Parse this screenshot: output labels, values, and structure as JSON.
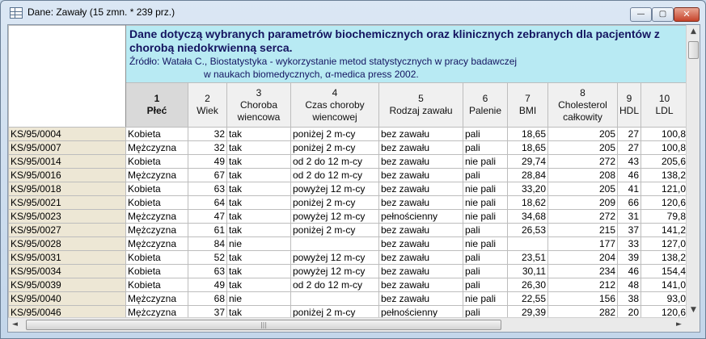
{
  "window": {
    "title": "Dane: Zawały (15 zmn. * 239 prz.)",
    "buttons": {
      "minimize": "—",
      "maximize": "▢",
      "close": "✕"
    }
  },
  "info": {
    "title": "Dane dotyczą wybranych parametrów biochemicznych oraz klinicznych zebranych dla pacjentów z chorobą niedokrwienną serca.",
    "source_line1": "Źródło: Watała C., Biostatystyka - wykorzystanie metod statystycznych w pracy badawczej",
    "source_line2": "w naukach biomedycznych, α-medica press 2002."
  },
  "columns": [
    {
      "num": "1",
      "name": "Płeć"
    },
    {
      "num": "2",
      "name": "Wiek"
    },
    {
      "num": "3",
      "name": "Choroba wiencowa"
    },
    {
      "num": "4",
      "name": "Czas choroby wiencowej"
    },
    {
      "num": "5",
      "name": "Rodzaj zawału"
    },
    {
      "num": "6",
      "name": "Palenie"
    },
    {
      "num": "7",
      "name": "BMI"
    },
    {
      "num": "8",
      "name": "Cholesterol całkowity"
    },
    {
      "num": "9",
      "name": "HDL"
    },
    {
      "num": "10",
      "name": "LDL"
    }
  ],
  "rows": [
    [
      "KS/95/0004",
      "Kobieta",
      "32",
      "tak",
      "poniżej 2 m-cy",
      "bez zawału",
      "pali",
      "18,65",
      "205",
      "27",
      "100,8"
    ],
    [
      "KS/95/0007",
      "Mężczyzna",
      "32",
      "tak",
      "poniżej 2 m-cy",
      "bez zawału",
      "pali",
      "18,65",
      "205",
      "27",
      "100,8"
    ],
    [
      "KS/95/0014",
      "Kobieta",
      "49",
      "tak",
      "od 2 do 12 m-cy",
      "bez zawału",
      "nie pali",
      "29,74",
      "272",
      "43",
      "205,6"
    ],
    [
      "KS/95/0016",
      "Mężczyzna",
      "67",
      "tak",
      "od 2 do 12 m-cy",
      "bez zawału",
      "pali",
      "28,84",
      "208",
      "46",
      "138,2"
    ],
    [
      "KS/95/0018",
      "Kobieta",
      "63",
      "tak",
      "powyżej 12 m-cy",
      "bez zawału",
      "nie pali",
      "33,20",
      "205",
      "41",
      "121,0"
    ],
    [
      "KS/95/0021",
      "Kobieta",
      "64",
      "tak",
      "poniżej 2 m-cy",
      "bez zawału",
      "nie pali",
      "18,62",
      "209",
      "66",
      "120,6"
    ],
    [
      "KS/95/0023",
      "Mężczyzna",
      "47",
      "tak",
      "powyżej 12 m-cy",
      "pełnościenny",
      "nie pali",
      "34,68",
      "272",
      "31",
      "79,8"
    ],
    [
      "KS/95/0027",
      "Mężczyzna",
      "61",
      "tak",
      "poniżej 2 m-cy",
      "bez zawału",
      "pali",
      "26,53",
      "215",
      "37",
      "141,2"
    ],
    [
      "KS/95/0028",
      "Mężczyzna",
      "84",
      "nie",
      "",
      "bez zawału",
      "nie pali",
      "",
      "177",
      "33",
      "127,0"
    ],
    [
      "KS/95/0031",
      "Kobieta",
      "52",
      "tak",
      "powyżej 12 m-cy",
      "bez zawału",
      "pali",
      "23,51",
      "204",
      "39",
      "138,2"
    ],
    [
      "KS/95/0034",
      "Kobieta",
      "63",
      "tak",
      "powyżej 12 m-cy",
      "bez zawału",
      "pali",
      "30,11",
      "234",
      "46",
      "154,4"
    ],
    [
      "KS/95/0039",
      "Kobieta",
      "49",
      "tak",
      "od 2 do 12 m-cy",
      "bez zawału",
      "pali",
      "26,30",
      "212",
      "48",
      "141,0"
    ],
    [
      "KS/95/0040",
      "Mężczyzna",
      "68",
      "nie",
      "",
      "bez zawału",
      "nie pali",
      "22,55",
      "156",
      "38",
      "93,0"
    ],
    [
      "KS/95/0046",
      "Mężczyzna",
      "37",
      "tak",
      "poniżej 2 m-cy",
      "pełnościenny",
      "pali",
      "29,39",
      "282",
      "20",
      "120,6"
    ]
  ],
  "scroll": {
    "up": "▲",
    "down": "▼",
    "left": "◄",
    "right": "►",
    "grip": "|||"
  }
}
